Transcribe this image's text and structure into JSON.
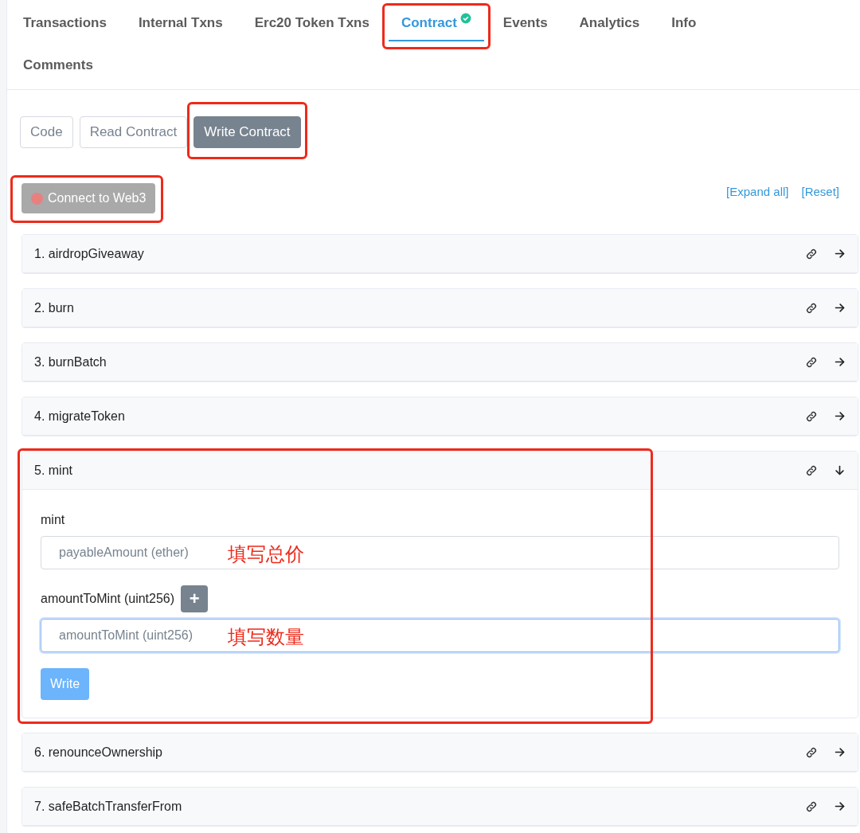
{
  "tabs": [
    {
      "label": "Transactions",
      "selected": false,
      "highlighted": false,
      "verified": false
    },
    {
      "label": "Internal Txns",
      "selected": false,
      "highlighted": false,
      "verified": false
    },
    {
      "label": "Erc20 Token Txns",
      "selected": false,
      "highlighted": false,
      "verified": false
    },
    {
      "label": "Contract",
      "selected": true,
      "highlighted": true,
      "verified": true
    },
    {
      "label": "Events",
      "selected": false,
      "highlighted": false,
      "verified": false
    },
    {
      "label": "Analytics",
      "selected": false,
      "highlighted": false,
      "verified": false
    },
    {
      "label": "Info",
      "selected": false,
      "highlighted": false,
      "verified": false
    },
    {
      "label": "Comments",
      "selected": false,
      "highlighted": false,
      "verified": false
    }
  ],
  "subtabs": [
    {
      "label": "Code",
      "selected": false,
      "highlighted": false
    },
    {
      "label": "Read Contract",
      "selected": false,
      "highlighted": false
    },
    {
      "label": "Write Contract",
      "selected": true,
      "highlighted": true
    }
  ],
  "connect_button": {
    "label": "Connect to Web3",
    "connected": false,
    "highlighted": true
  },
  "links": [
    "[Expand all]",
    "[Reset]"
  ],
  "functions": [
    {
      "title": "1. airdropGiveaway",
      "expanded": false,
      "highlighted": false
    },
    {
      "title": "2. burn",
      "expanded": false,
      "highlighted": false
    },
    {
      "title": "3. burnBatch",
      "expanded": false,
      "highlighted": false
    },
    {
      "title": "4. migrateToken",
      "expanded": false,
      "highlighted": false
    },
    {
      "title": "5. mint",
      "expanded": true,
      "highlighted": true,
      "inputs": [
        {
          "label": "mint",
          "placeholder": "payableAmount (ether)",
          "annotation": "填写总价",
          "focused": false,
          "add_button": false
        },
        {
          "label": "amountToMint (uint256)",
          "placeholder": "amountToMint (uint256)",
          "annotation": "填写数量",
          "focused": true,
          "add_button": true,
          "add_label": "+"
        }
      ],
      "button": "Write"
    },
    {
      "title": "6. renounceOwnership",
      "expanded": false,
      "highlighted": false
    },
    {
      "title": "7. safeBatchTransferFrom",
      "expanded": false,
      "highlighted": false
    }
  ]
}
